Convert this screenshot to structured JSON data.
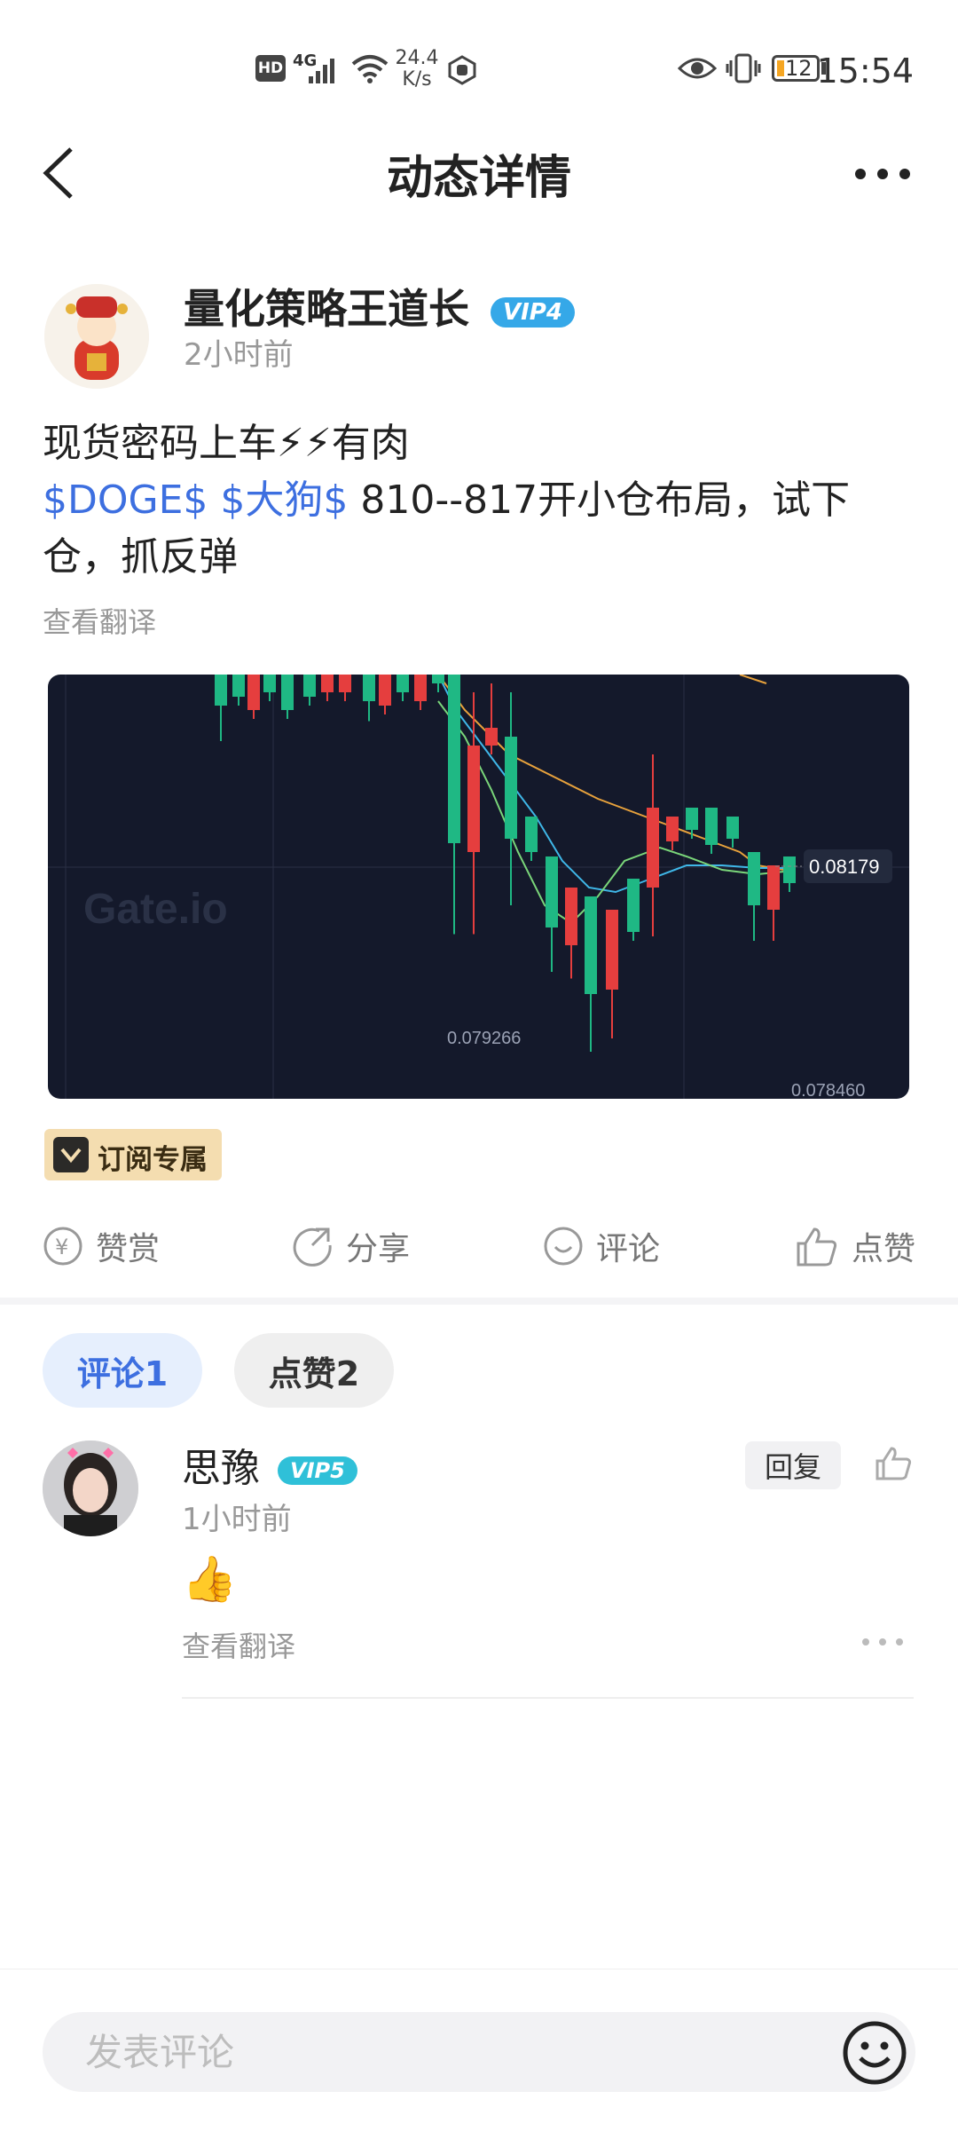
{
  "status_bar": {
    "hd": "HD",
    "network": "4G",
    "speed_value": "24.4",
    "speed_unit": "K/s",
    "battery": "12",
    "time": "15:54"
  },
  "header": {
    "title": "动态详情"
  },
  "post": {
    "author": "量化策略王道长",
    "author_vip": "VIP4",
    "time": "2小时前",
    "line1": "现货密码上车⚡⚡有肉",
    "tag1": "$DOGE$",
    "tag2": "$大狗$",
    "line2_rest": " 810--817开小仓布局，试下仓，抓反弹",
    "translate": "查看翻译"
  },
  "chart": {
    "watermark": "Gate.io",
    "last_price": "0.08179",
    "low_label": "0.079266",
    "bottom_label": "0.078460"
  },
  "subscribe": {
    "label": "订阅专属"
  },
  "actions": {
    "tip": "赞赏",
    "share": "分享",
    "comment": "评论",
    "like": "点赞"
  },
  "tabs": {
    "comments": "评论1",
    "likes": "点赞2"
  },
  "comment": {
    "name": "思豫",
    "vip": "VIP5",
    "time": "1小时前",
    "content": "👍",
    "translate": "查看翻译",
    "reply": "回复"
  },
  "input": {
    "placeholder": "发表评论"
  },
  "colors": {
    "accent_blue": "#3d6fe0",
    "vip4": "#35a8e8",
    "vip5": "#2fc0d8",
    "chart_bg": "#14192b",
    "candle_up": "#1fb884",
    "candle_down": "#e53e3e"
  }
}
